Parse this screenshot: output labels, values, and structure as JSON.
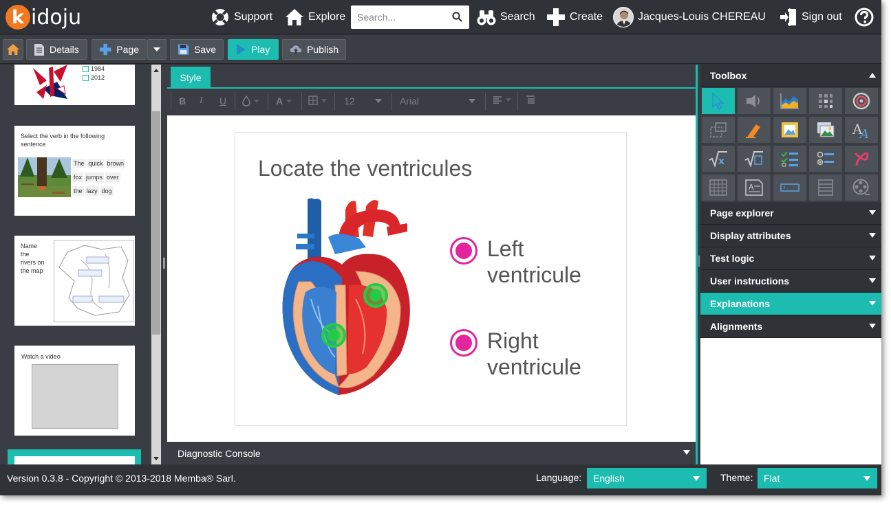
{
  "app": {
    "logo_text": "idoju",
    "logo_k": "k"
  },
  "nav": {
    "support": "Support",
    "explore": "Explore",
    "search_placeholder": "Search...",
    "search": "Search",
    "create": "Create",
    "user": "Jacques-Louis CHEREAU",
    "signout": "Sign out"
  },
  "toolbar": {
    "details": "Details",
    "page": "Page",
    "save": "Save",
    "play": "Play",
    "publish": "Publish"
  },
  "thumbnails": {
    "t1": {
      "opt1": "1984",
      "opt2": "2012"
    },
    "t2": {
      "title": "Select the verb in the following sentence",
      "words": [
        "The",
        "quick",
        "brown",
        "fox",
        "jumps",
        "over",
        "the",
        "lazy",
        "dog"
      ]
    },
    "t3": {
      "title": "Name the rivers on the map"
    },
    "t4": {
      "title": "Watch a video"
    }
  },
  "editor": {
    "style_tab": "Style",
    "font_size": "12",
    "font_family": "Arial",
    "bold": "B",
    "italic": "I",
    "underline": "U",
    "color_a": "A"
  },
  "stage": {
    "title": "Locate the ventricules",
    "options": [
      {
        "label": "Left ventricule"
      },
      {
        "label": "Right ventricule"
      }
    ]
  },
  "diagnostic": "Diagnostic Console",
  "right": {
    "toolbox": "Toolbox",
    "sections": [
      "Page explorer",
      "Display attributes",
      "Test logic",
      "User instructions",
      "Explanations",
      "Alignments"
    ],
    "active_section": "Explanations"
  },
  "footer": {
    "version": "Version 0.3.8 - Copyright © 2013-2018 Memba® Sarl.",
    "language_label": "Language:",
    "language_value": "English",
    "theme_label": "Theme:",
    "theme_value": "Flat"
  },
  "colors": {
    "accent": "#1cbcb0",
    "logo": "#f07a22",
    "hotspot": "#e4259d",
    "dropzone": "#22cc44"
  }
}
